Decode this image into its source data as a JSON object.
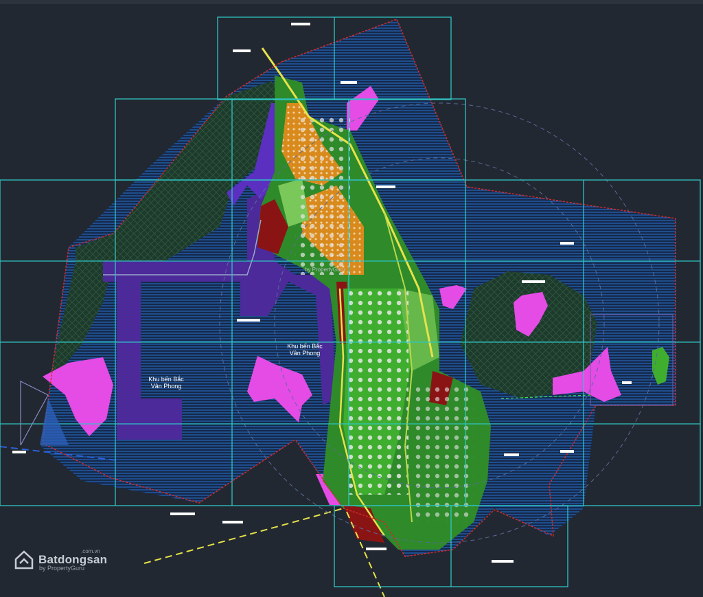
{
  "map": {
    "labels": {
      "west_zone": "Khu bến Bắc\nVân Phong",
      "center_zone": "Khu bến Bắc\nVân Phong"
    },
    "watermark": {
      "brand": "Batdongsan",
      "domain": ".com.vn",
      "sub": "by PropertyGuru",
      "center_mark": "by PropertyGuru"
    },
    "colors": {
      "background": "#222831",
      "sea_hatch": "#1f5aa8",
      "grid_lines": "#2fc4c4",
      "boundary": "#d42a2a",
      "vegetation": "#1f6e2a",
      "industrial": "#5a2bb0",
      "tourism": "#e04ae0",
      "residential": "#d98a1c",
      "mixed_use": "#8a1414",
      "green_space": "#3fae2f",
      "road": "#e6e34a"
    }
  }
}
